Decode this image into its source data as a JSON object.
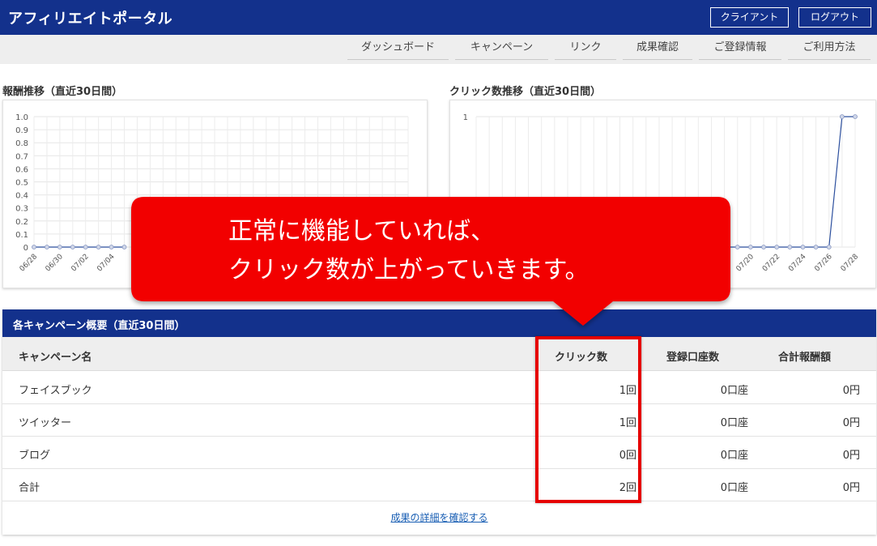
{
  "header": {
    "title": "アフィリエイトポータル",
    "client_button": "クライアント",
    "logout_button": "ログアウト"
  },
  "nav": {
    "items": [
      "ダッシュボード",
      "キャンペーン",
      "リンク",
      "成果確認",
      "ご登録情報",
      "ご利用方法"
    ]
  },
  "reward_chart": {
    "section_title": "報酬推移（直近30日間）"
  },
  "click_chart": {
    "section_title": "クリック数推移（直近30日間）"
  },
  "chart_data": [
    {
      "type": "line",
      "title": "報酬推移（直近30日間）",
      "x_visible_ticks": [
        "06/28",
        "06/30",
        "07/02",
        "07/04"
      ],
      "ylim": [
        0,
        1.0
      ],
      "y_ticks": [
        "1.0",
        "0.9",
        "0.8",
        "0.7",
        "0.6",
        "0.5",
        "0.4",
        "0.3",
        "0.2",
        "0.1",
        "0"
      ],
      "series": [
        {
          "values": [
            0,
            0,
            0,
            0,
            0,
            0,
            0,
            0
          ]
        }
      ],
      "grid": true
    },
    {
      "type": "line",
      "title": "クリック数推移（直近30日間）",
      "x_visible_ticks": [
        "07/20",
        "07/22",
        "07/24",
        "07/26",
        "07/28"
      ],
      "y_ticks": [
        "1"
      ],
      "ylim": [
        0,
        1
      ],
      "series": [
        {
          "values": [
            0,
            0,
            0,
            0,
            0,
            0,
            0,
            0,
            0,
            0,
            0,
            0,
            0,
            0,
            0,
            0,
            0,
            0,
            0,
            0,
            0,
            0,
            0,
            0,
            0,
            0,
            0,
            0,
            1,
            1
          ]
        }
      ],
      "grid": true
    }
  ],
  "campaigns": {
    "title": "各キャンペーン概要（直近30日間）",
    "columns": [
      "キャンペーン名",
      "クリック数",
      "登録口座数",
      "合計報酬額"
    ],
    "rows": [
      [
        "フェイスブック",
        "1回",
        "0口座",
        "0円"
      ],
      [
        "ツイッター",
        "1回",
        "0口座",
        "0円"
      ],
      [
        "ブログ",
        "0回",
        "0口座",
        "0円"
      ],
      [
        "合計",
        "2回",
        "0口座",
        "0円"
      ]
    ],
    "detail_link": "成果の詳細を確認する"
  },
  "callout": {
    "line1": "正常に機能していれば、",
    "line2": "クリック数が上がっていきます。",
    "color": "#f20000"
  },
  "colors": {
    "header": "#13318c",
    "highlight": "#e60000",
    "line": "#2c4f9e"
  }
}
